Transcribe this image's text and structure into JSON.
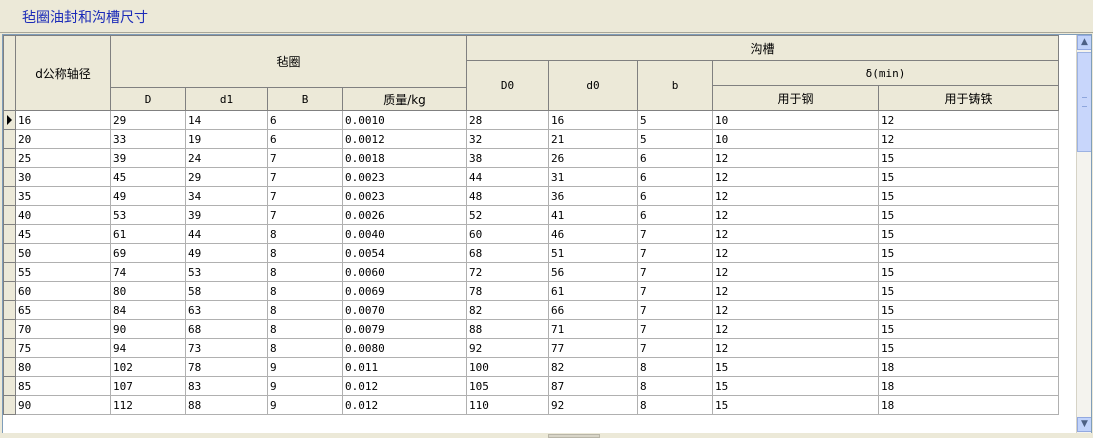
{
  "window": {
    "title": "毡圈油封和沟槽尺寸"
  },
  "grid": {
    "headers": {
      "shaft": "d公称轴径",
      "felt_group": "毡圈",
      "groove_group": "沟槽",
      "delta_group": "δ(min)",
      "felt_cols": [
        "D",
        "d1",
        "B",
        "质量/kg"
      ],
      "groove_cols": [
        "D0",
        "d0",
        "b"
      ],
      "delta_cols": [
        "用于钢",
        "用于铸铁"
      ]
    },
    "rows": [
      [
        "16",
        "29",
        "14",
        "6",
        "0.0010",
        "28",
        "16",
        "5",
        "10",
        "12"
      ],
      [
        "20",
        "33",
        "19",
        "6",
        "0.0012",
        "32",
        "21",
        "5",
        "10",
        "12"
      ],
      [
        "25",
        "39",
        "24",
        "7",
        "0.0018",
        "38",
        "26",
        "6",
        "12",
        "15"
      ],
      [
        "30",
        "45",
        "29",
        "7",
        "0.0023",
        "44",
        "31",
        "6",
        "12",
        "15"
      ],
      [
        "35",
        "49",
        "34",
        "7",
        "0.0023",
        "48",
        "36",
        "6",
        "12",
        "15"
      ],
      [
        "40",
        "53",
        "39",
        "7",
        "0.0026",
        "52",
        "41",
        "6",
        "12",
        "15"
      ],
      [
        "45",
        "61",
        "44",
        "8",
        "0.0040",
        "60",
        "46",
        "7",
        "12",
        "15"
      ],
      [
        "50",
        "69",
        "49",
        "8",
        "0.0054",
        "68",
        "51",
        "7",
        "12",
        "15"
      ],
      [
        "55",
        "74",
        "53",
        "8",
        "0.0060",
        "72",
        "56",
        "7",
        "12",
        "15"
      ],
      [
        "60",
        "80",
        "58",
        "8",
        "0.0069",
        "78",
        "61",
        "7",
        "12",
        "15"
      ],
      [
        "65",
        "84",
        "63",
        "8",
        "0.0070",
        "82",
        "66",
        "7",
        "12",
        "15"
      ],
      [
        "70",
        "90",
        "68",
        "8",
        "0.0079",
        "88",
        "71",
        "7",
        "12",
        "15"
      ],
      [
        "75",
        "94",
        "73",
        "8",
        "0.0080",
        "92",
        "77",
        "7",
        "12",
        "15"
      ],
      [
        "80",
        "102",
        "78",
        "9",
        "0.011",
        "100",
        "82",
        "8",
        "15",
        "18"
      ],
      [
        "85",
        "107",
        "83",
        "9",
        "0.012",
        "105",
        "87",
        "8",
        "15",
        "18"
      ],
      [
        "90",
        "112",
        "88",
        "9",
        "0.012",
        "110",
        "92",
        "8",
        "15",
        "18"
      ]
    ],
    "current_row": 0
  },
  "scrollbar": {
    "up_glyph": "▲",
    "down_glyph": "▼"
  }
}
